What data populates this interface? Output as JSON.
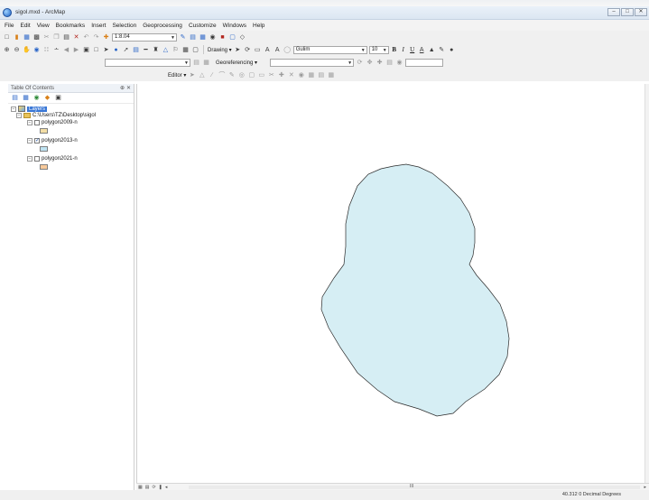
{
  "window": {
    "title": "sigol.mxd - ArcMap",
    "controls": [
      "–",
      "□",
      "✕"
    ]
  },
  "menu": [
    "File",
    "Edit",
    "View",
    "Bookmarks",
    "Insert",
    "Selection",
    "Geoprocessing",
    "Customize",
    "Windows",
    "Help"
  ],
  "toolbar": {
    "scale_value": "1:8.04",
    "drawing_label": "Drawing ▾",
    "font_name": "Gulim",
    "font_size": "10",
    "bold": "B",
    "italic": "I",
    "underline": "U",
    "georeferencing_label": "Georeferencing ▾",
    "editor_label": "Editor ▾"
  },
  "toc": {
    "title": "Table Of Contents",
    "pin": "⊕",
    "close": "✕",
    "root_label": "Layers",
    "folder_label": "C:\\Users\\TZ\\Desktop\\sigol",
    "layers": [
      {
        "name": "polygon2009-n",
        "checked": false,
        "swatch": "#f3dea5",
        "expander": "−",
        "check": ""
      },
      {
        "name": "polygon2013-n",
        "checked": true,
        "swatch": "#bfe3f1",
        "expander": "−",
        "check": "✓"
      },
      {
        "name": "polygon2021-n",
        "checked": false,
        "swatch": "#f7c99a",
        "expander": "−",
        "check": ""
      }
    ]
  },
  "map": {
    "polygon_fill": "#d6eef4",
    "polygon_stroke": "#2a2a2a"
  },
  "scroll": {
    "left_arrow": "◂",
    "right_arrow": "▸",
    "center": "III"
  },
  "status": {
    "coordinates": "40.312  0 Decimal Degrees"
  },
  "colors": {
    "titlebar": "#dce6f2",
    "selection": "#3876d6",
    "toolbar": "#f0f0f0"
  }
}
